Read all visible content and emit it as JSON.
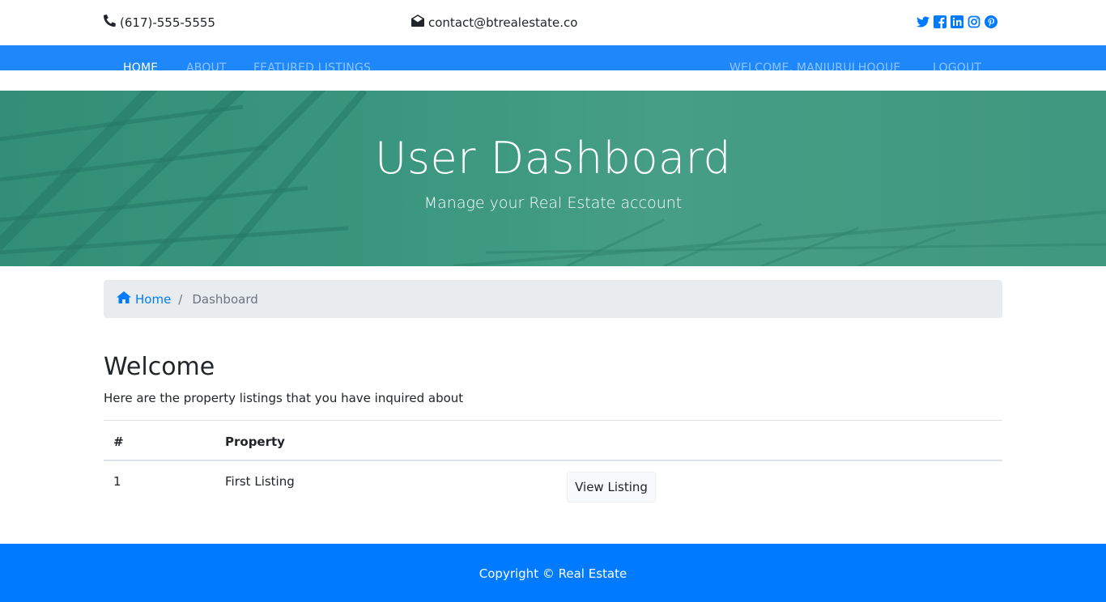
{
  "topbar": {
    "phone": "(617)-555-5555",
    "email": "contact@btrealestate.co",
    "socials": [
      "twitter-icon",
      "facebook-icon",
      "linkedin-icon",
      "instagram-icon",
      "pinterest-icon"
    ]
  },
  "nav": {
    "home": "Home",
    "about": "About",
    "featured": "Featured Listings",
    "welcome": "Welcome, Manjurulhoque",
    "logout": "Logout"
  },
  "hero": {
    "title": "User Dashboard",
    "subtitle": "Manage your Real Estate account"
  },
  "breadcrumb": {
    "home": "Home",
    "separator": "/",
    "current": "Dashboard"
  },
  "main": {
    "heading": "Welcome",
    "intro": "Here are the property listings that you have inquired about",
    "table": {
      "columns": [
        "#",
        "Property"
      ],
      "rows": [
        {
          "num": "1",
          "property": "First Listing",
          "action": "View Listing"
        }
      ]
    }
  },
  "footer": {
    "copyright": "Copyright © Real Estate"
  },
  "colors": {
    "primary": "#007bff",
    "navbar": "#1e88fa",
    "hero": "#3a957e",
    "breadcrumb_bg": "#e9ecef"
  }
}
